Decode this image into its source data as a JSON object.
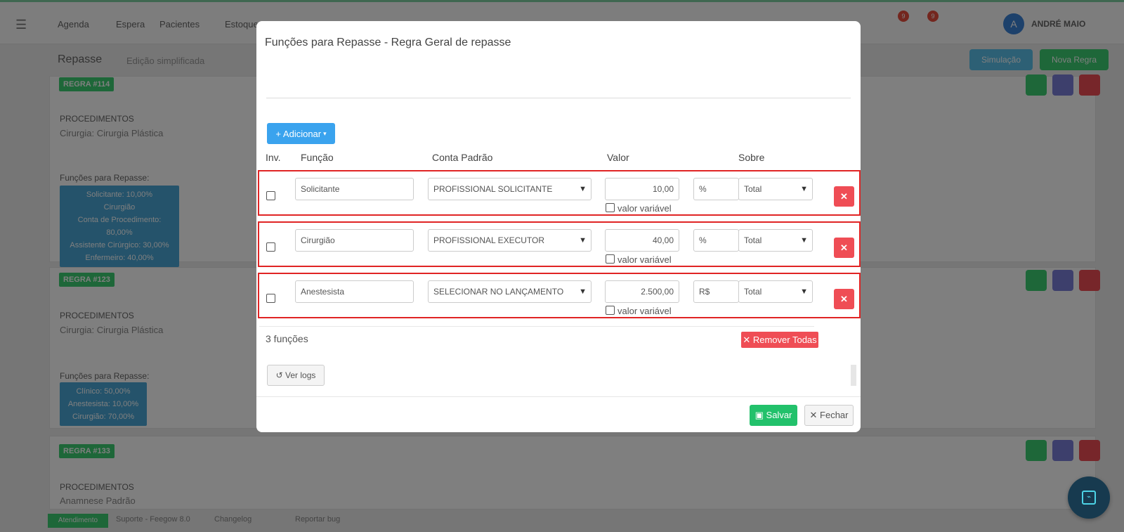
{
  "modal": {
    "title": "Funções para Repasse - Regra Geral de repasse",
    "add_button": "Adicionar",
    "columns": {
      "inv": "Inv.",
      "funcao": "Função",
      "conta": "Conta Padrão",
      "valor": "Valor",
      "sobre": "Sobre"
    },
    "rows": [
      {
        "funcao": "Solicitante",
        "conta": "PROFISSIONAL SOLICITANTE",
        "valor": "10,00",
        "variavel_label": "valor variável",
        "unidade": "%",
        "sobre": "Total",
        "checked": false
      },
      {
        "funcao": "Cirurgião",
        "conta": "PROFISSIONAL EXECUTOR",
        "valor": "40,00",
        "variavel_label": "valor variável",
        "unidade": "%",
        "sobre": "Total",
        "checked": false
      },
      {
        "funcao": "Anestesista",
        "conta": "SELECIONAR NO LANÇAMENTO",
        "valor": "2.500,00",
        "variavel_label": "valor variável",
        "unidade": "R$",
        "sobre": "Total",
        "checked": false
      }
    ],
    "count_label": "3 funções",
    "remove_all_label": "Remover Todas",
    "logs_label": "Ver logs",
    "save_label": "Salvar",
    "close_label": "Fechar",
    "colors": {
      "primary": "#3aa3ee",
      "danger": "#ef4d55",
      "success": "#22c16b",
      "highlight_border": "#e02424"
    }
  },
  "background": {
    "nav": {
      "items": [
        "Agenda",
        "Espera",
        "Pacientes",
        "Estoque"
      ],
      "badges": [
        "9",
        "9"
      ],
      "avatar_initial": "A",
      "user": "ANDRÉ MAIO"
    },
    "page_title": "Repasse",
    "page_subtitle": "Edição simplificada",
    "buttons": {
      "preview": "Simulação",
      "new_rule": "Nova Regra"
    },
    "cards": [
      {
        "tag": "REGRA #114",
        "proc_label": "PROCEDIMENTOS",
        "proc_value": "Cirurgia: Cirurgia Plástica",
        "fn_label": "Funções para Repasse:",
        "fn_items": [
          "Solicitante: 10,00%",
          "Cirurgião",
          "Conta de Procedimento: 80,00%",
          "Assistente Cirúrgico: 30,00%",
          "Enfermeiro: 40,00%"
        ]
      },
      {
        "tag": "REGRA #123",
        "proc_label": "PROCEDIMENTOS",
        "proc_value": "Cirurgia: Cirurgia Plástica",
        "fn_label": "Funções para Repasse:",
        "fn_items": [
          "Clínico: 50,00%",
          "Anestesista: 10,00%",
          "Cirurgião: 70,00%"
        ]
      },
      {
        "tag": "REGRA #133",
        "proc_label": "PROCEDIMENTOS",
        "proc_value": "Anamnese Padrão"
      }
    ],
    "footer": {
      "tag": "Atendimento",
      "links": [
        "Suporte - Feegow 8.0",
        "Changelog",
        "Reportar bug"
      ]
    }
  }
}
